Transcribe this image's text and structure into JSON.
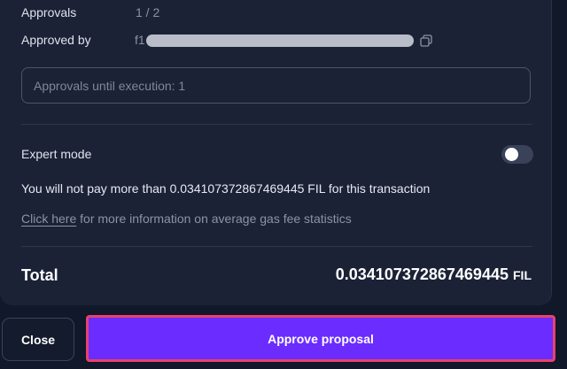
{
  "approvals": {
    "label": "Approvals",
    "value": "1 / 2"
  },
  "approved_by": {
    "label": "Approved by",
    "address_prefix": "f1",
    "copy_icon": "copy-icon"
  },
  "approvals_until_execution": {
    "text": "Approvals until execution: 1"
  },
  "expert_mode": {
    "label": "Expert mode",
    "enabled": false
  },
  "fee_notice": {
    "text": "You will not pay more than 0.034107372867469445 FIL for this transaction"
  },
  "gas_info": {
    "link_text": "Click here",
    "rest_text": " for more information on average gas fee statistics"
  },
  "total": {
    "label": "Total",
    "amount": "0.034107372867469445",
    "unit": "FIL"
  },
  "actions": {
    "close_label": "Close",
    "approve_label": "Approve proposal"
  },
  "colors": {
    "background": "#10182a",
    "card": "#1b2236",
    "accent": "#6b2cff",
    "highlight_border": "#e8426b"
  }
}
